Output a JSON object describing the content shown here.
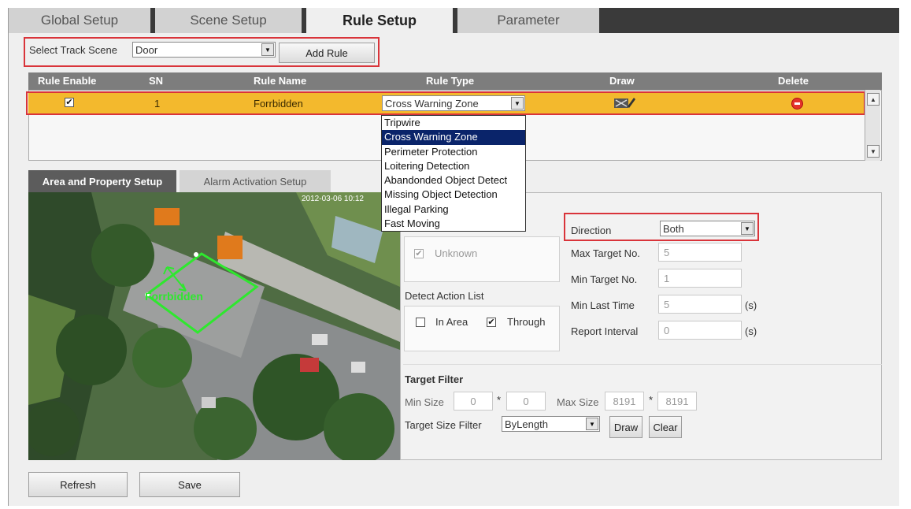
{
  "tabs": [
    "Global Setup",
    "Scene Setup",
    "Rule Setup",
    "Parameter"
  ],
  "scene": {
    "label": "Select Track Scene",
    "value": "Door",
    "add_rule": "Add Rule"
  },
  "table": {
    "headers": [
      "Rule Enable",
      "SN",
      "Rule Name",
      "Rule Type",
      "Draw",
      "Delete"
    ],
    "row": {
      "enabled": "✔",
      "sn": "1",
      "name": "Forrbidden",
      "type": "Cross Warning Zone"
    }
  },
  "rule_type_options": [
    "Tripwire",
    "Cross Warning Zone",
    "Perimeter Protection",
    "Loitering Detection",
    "Abandonded Object Detect",
    "Missing Object Detection",
    "Illegal Parking",
    "Fast Moving"
  ],
  "subtabs": [
    "Area and Property Setup",
    "Alarm Activation Setup"
  ],
  "video": {
    "timestamp": "2012-03-06 10:12",
    "zone_label": "Forrbidden"
  },
  "props": {
    "target_type_value": "Unknown",
    "direction_label": "Direction",
    "direction_value": "Both",
    "max_target_label": "Max Target No.",
    "max_target": "5",
    "min_target_label": "Min Target No.",
    "min_target": "1",
    "min_last_label": "Min Last Time",
    "min_last": "5",
    "report_label": "Report Interval",
    "report": "0",
    "unit": "(s)",
    "action_list_label": "Detect Action List",
    "in_area": "In Area",
    "through": "Through",
    "target_filter_label": "Target Filter",
    "min_size_label": "Min Size",
    "min_w": "0",
    "min_h": "0",
    "max_size_label": "Max Size",
    "max_w": "8191",
    "max_h": "8191",
    "times": "*",
    "size_filter_label": "Target Size Filter",
    "size_filter_value": "ByLength",
    "draw": "Draw",
    "clear": "Clear"
  },
  "footer": {
    "refresh": "Refresh",
    "save": "Save"
  },
  "colors": {
    "selected_row": "#f3b92d",
    "highlight": "#d9343a",
    "zone": "#2ee82e"
  }
}
